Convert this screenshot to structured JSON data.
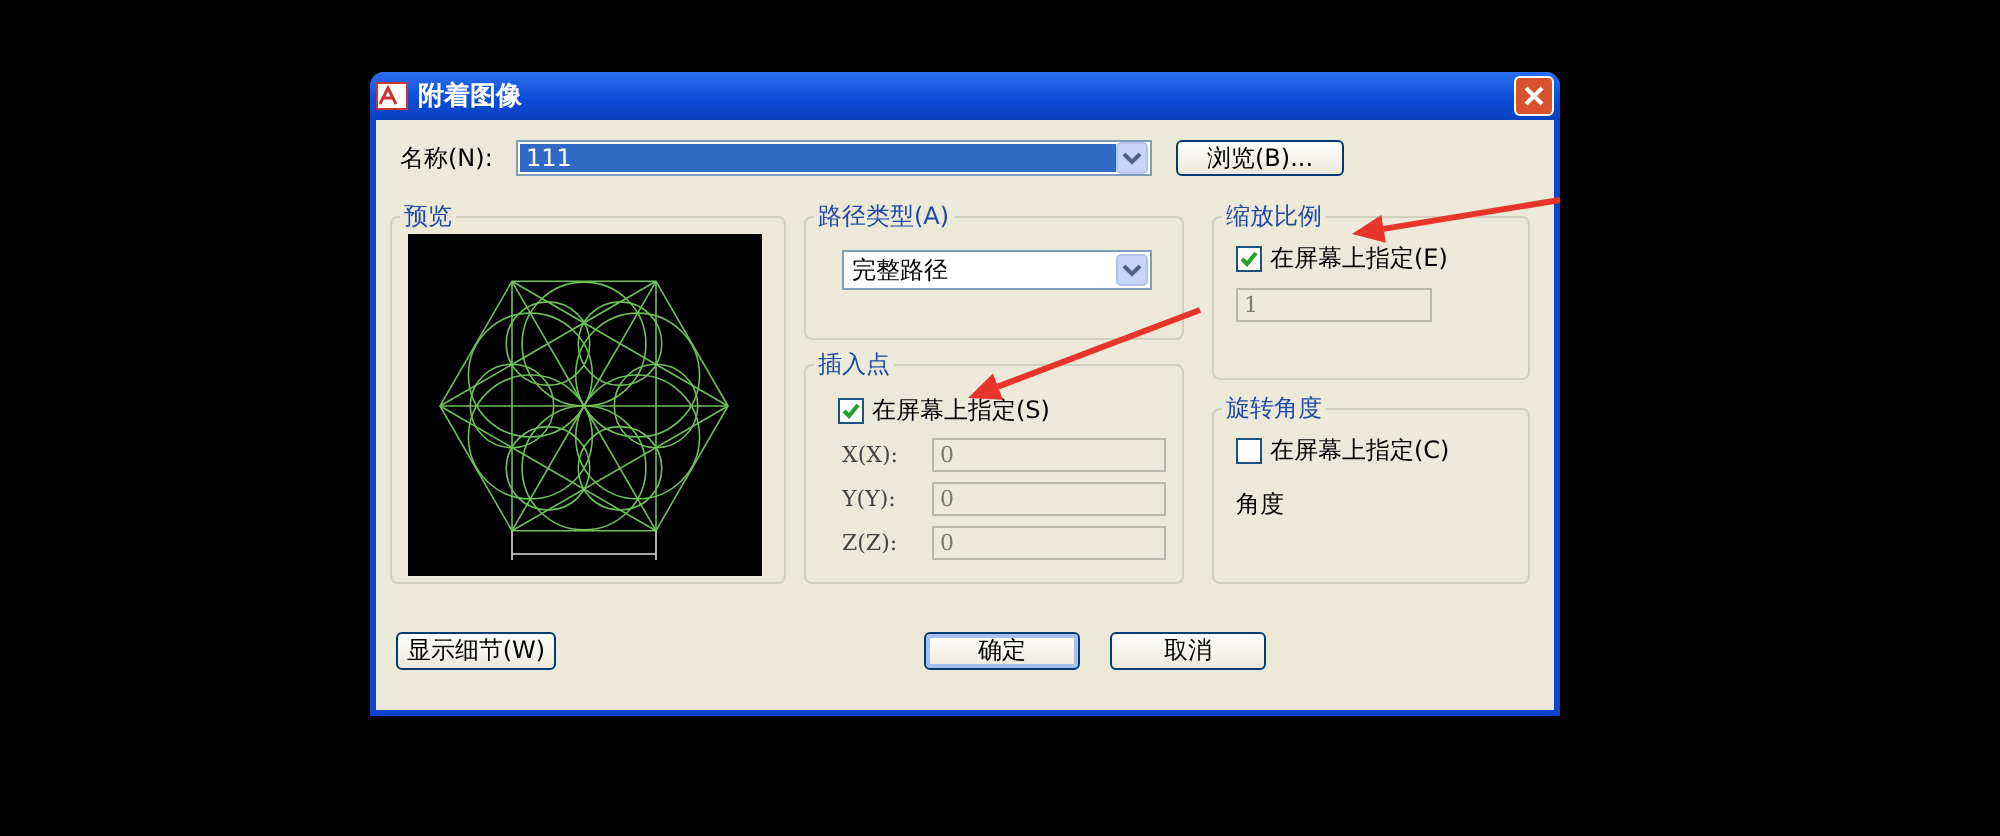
{
  "window": {
    "title": "附着图像"
  },
  "name_field": {
    "label": "名称(N):",
    "value": "111"
  },
  "browse_button": {
    "label": "浏览(B)..."
  },
  "preview": {
    "title": "预览"
  },
  "path_type": {
    "title": "路径类型(A)",
    "value": "完整路径"
  },
  "insertion_point": {
    "title": "插入点",
    "specify_on_screen": {
      "label": "在屏幕上指定(S)",
      "checked": true
    },
    "coords": [
      {
        "label": "X(X):",
        "value": "0",
        "disabled": true
      },
      {
        "label": "Y(Y):",
        "value": "0",
        "disabled": true
      },
      {
        "label": "Z(Z):",
        "value": "0",
        "disabled": true
      }
    ]
  },
  "scale": {
    "title": "缩放比例",
    "specify_on_screen": {
      "label": "在屏幕上指定(E)",
      "checked": true
    },
    "value": "1",
    "disabled": true
  },
  "rotation": {
    "title": "旋转角度",
    "specify_on_screen": {
      "label": "在屏幕上指定(C)",
      "checked": false
    },
    "angle_label": "角度"
  },
  "buttons": [
    {
      "label": "显示细节(W)",
      "default": false
    },
    {
      "label": "确定",
      "default": true
    },
    {
      "label": "取消",
      "default": false
    }
  ]
}
